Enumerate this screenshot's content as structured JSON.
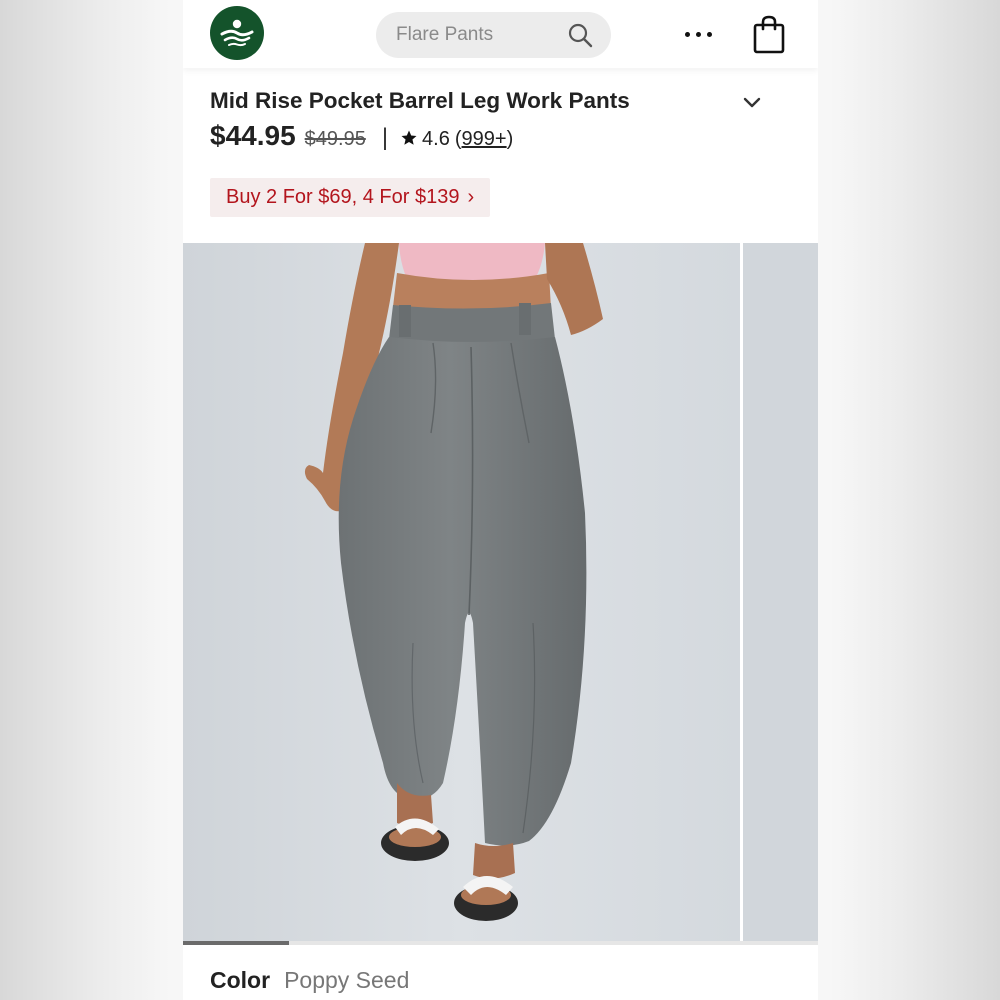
{
  "header": {
    "search_placeholder": "Flare Pants",
    "logo_icon": "brand-logo-icon",
    "search_icon": "search-icon",
    "more_icon": "more-dots-icon",
    "bag_icon": "shopping-bag-icon",
    "brand_color": "#14532b"
  },
  "product": {
    "title": "Mid Rise Pocket Barrel Leg Work Pants",
    "price": "$44.95",
    "original_price": "$49.95",
    "separator": "|",
    "rating": "4.6",
    "review_open": "(",
    "review_count": "999+",
    "review_close": ")",
    "expand_icon": "chevron-down-icon"
  },
  "promo": {
    "text": "Buy 2 For $69, 4 For $139",
    "arrow": "›",
    "text_color": "#b3151d"
  },
  "gallery": {
    "progress": 0.167
  },
  "color": {
    "label": "Color",
    "value": "Poppy Seed"
  }
}
